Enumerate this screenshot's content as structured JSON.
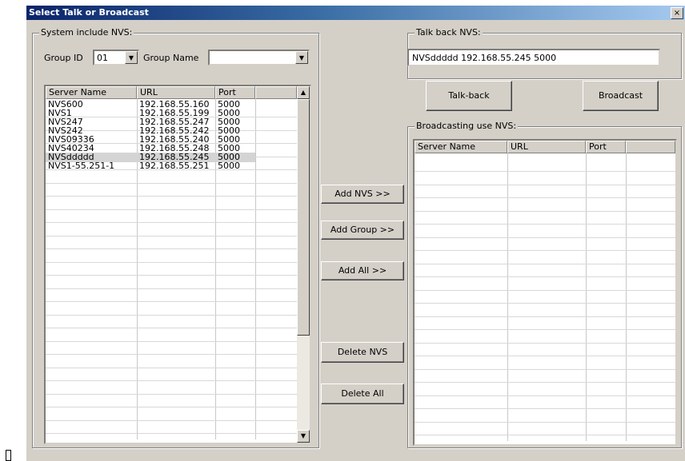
{
  "window": {
    "title": "Select Talk or Broadcast",
    "close_glyph": "×"
  },
  "system_group": {
    "legend": "System include NVS:",
    "group_id_label": "Group ID",
    "group_id_value": "01",
    "group_name_label": "Group Name",
    "group_name_value": "",
    "columns": [
      "Server Name",
      "URL",
      "Port"
    ],
    "rows": [
      [
        "NVS600",
        "192.168.55.160",
        "5000"
      ],
      [
        "NVS1",
        "192.168.55.199",
        "5000"
      ],
      [
        "NVS247",
        "192.168.55.247",
        "5000"
      ],
      [
        "NVS242",
        "192.168.55.242",
        "5000"
      ],
      [
        "NVS09336",
        "192.168.55.240",
        "5000"
      ],
      [
        "NVS40234",
        "192.168.55.248",
        "5000"
      ],
      [
        "NVSddddd",
        "192.168.55.245",
        "5000"
      ],
      [
        "NVS1-55.251-1",
        "192.168.55.251",
        "5000"
      ]
    ],
    "selected_row_index": 6
  },
  "middle_buttons": {
    "add_nvs": "Add NVS >>",
    "add_group": "Add Group >>",
    "add_all": "Add All >>",
    "delete_nvs": "Delete NVS",
    "delete_all": "Delete All"
  },
  "talkback_group": {
    "legend": "Talk back NVS:",
    "value": "NVSddddd 192.168.55.245 5000"
  },
  "action_buttons": {
    "talkback": "Talk-back",
    "broadcast": "Broadcast"
  },
  "broadcast_group": {
    "legend": "Broadcasting use NVS:",
    "columns": [
      "Server Name",
      "URL",
      "Port"
    ],
    "rows": []
  },
  "icons": {
    "dropdown": "▼",
    "scroll_up": "▲",
    "scroll_down": "▼"
  }
}
